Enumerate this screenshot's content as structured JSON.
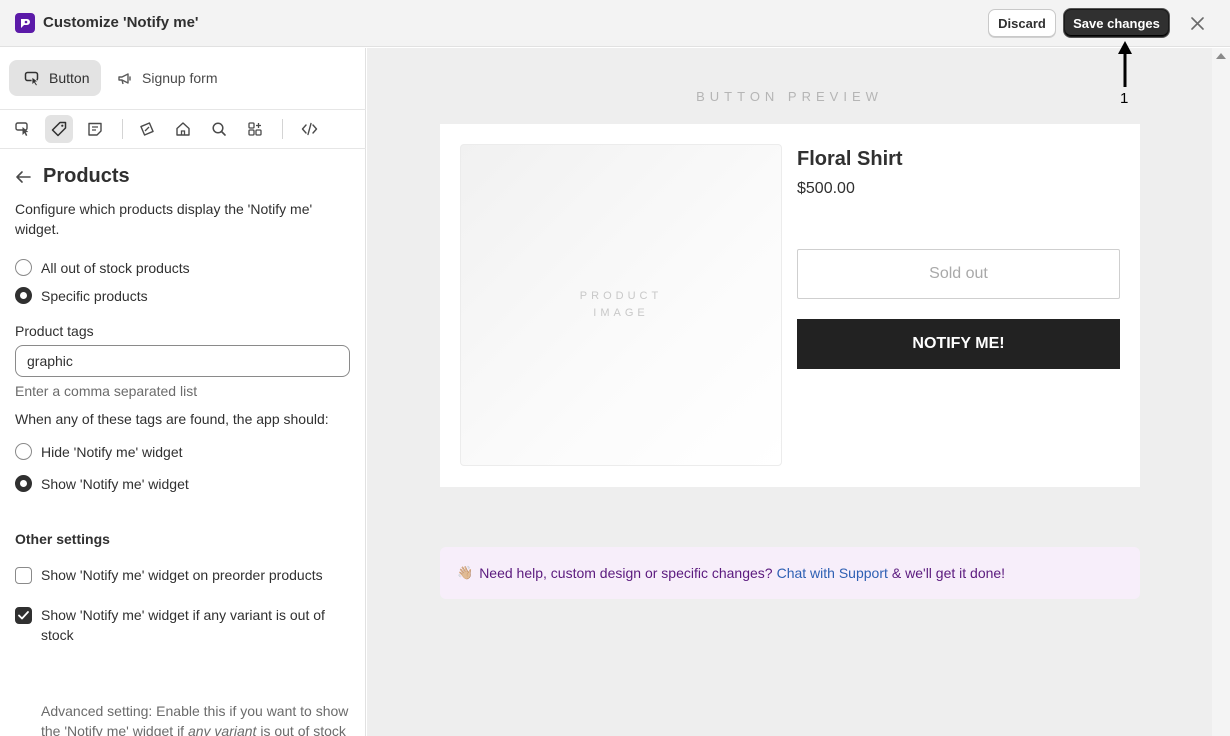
{
  "topbar": {
    "title": "Customize 'Notify me'",
    "discard_label": "Discard",
    "save_label": "Save changes"
  },
  "sidebar": {
    "tabs": [
      {
        "label": "Button",
        "icon": "cursor-click-icon",
        "active": true
      },
      {
        "label": "Signup form",
        "icon": "megaphone-icon",
        "active": false
      }
    ],
    "toolbar_icons": [
      "cursor-icon",
      "tag-icon",
      "note-icon",
      "discount-icon",
      "home-icon",
      "search-icon",
      "apps-icon",
      "code-icon"
    ],
    "section_title": "Products",
    "description": "Configure which products display the 'Notify me' widget.",
    "display_options": [
      {
        "label": "All out of stock products",
        "checked": false
      },
      {
        "label": "Specific products",
        "checked": true
      }
    ],
    "product_tags": {
      "label": "Product tags",
      "value": "graphic",
      "help": "Enter a comma separated list"
    },
    "tag_action_prompt": "When any of these tags are found, the app should:",
    "tag_actions": [
      {
        "label": "Hide 'Notify me' widget",
        "checked": false
      },
      {
        "label": "Show 'Notify me' widget",
        "checked": true
      }
    ],
    "other_settings": {
      "heading": "Other settings",
      "preorder": {
        "label": "Show 'Notify me' widget on preorder products",
        "checked": false
      },
      "any_variant": {
        "label": "Show 'Notify me' widget if any variant is out of stock",
        "checked": true
      },
      "advanced_prefix": "Advanced setting: Enable this if you want to show the 'Notify me' widget if ",
      "advanced_emphasis": "any variant",
      "advanced_suffix": " is out of stock"
    }
  },
  "preview": {
    "label": "BUTTON PREVIEW",
    "image_placeholder": "PRODUCT IMAGE",
    "product_name": "Floral Shirt",
    "price": "$500.00",
    "sold_out_label": "Sold out",
    "notify_label": "NOTIFY ME!",
    "help_prefix": "Need help, custom design or specific changes?",
    "help_link": "Chat with Support",
    "help_suffix": "& we'll get it done!"
  },
  "annotation": {
    "number": "1"
  },
  "colors": {
    "brand": "#5b1aa8",
    "primary_button": "#303030",
    "notify_button": "#222222",
    "help_banner_bg": "#f7eefa",
    "link": "#2d5fb3"
  }
}
